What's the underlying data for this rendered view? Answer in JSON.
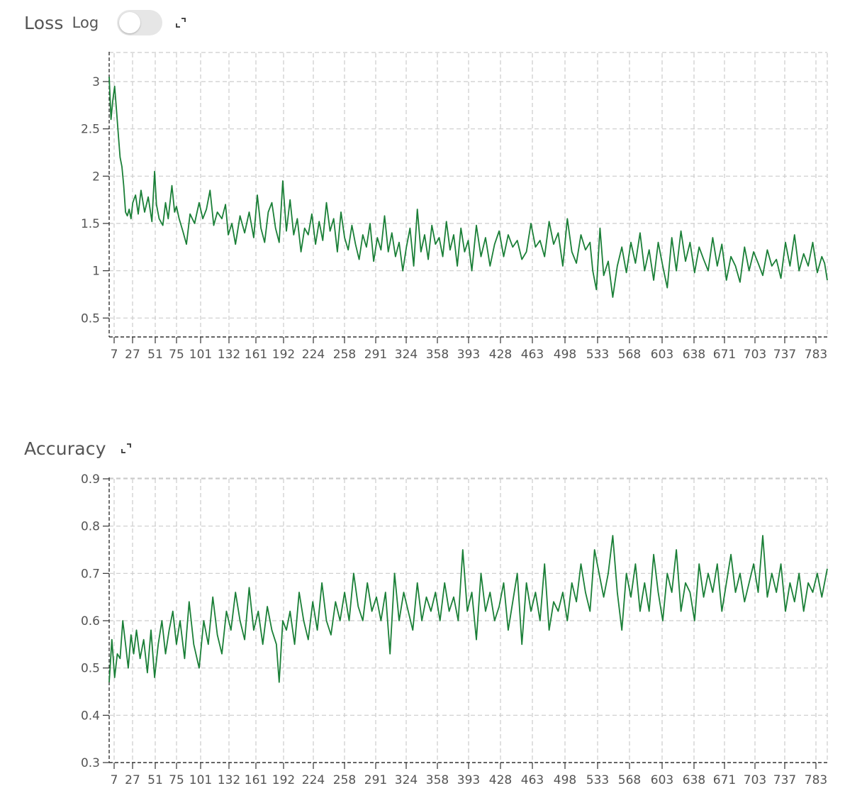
{
  "charts": {
    "loss": {
      "title": "Loss",
      "log_label": "Log",
      "log_enabled": false
    },
    "accuracy": {
      "title": "Accuracy"
    }
  },
  "colors": {
    "line": "#1a7f37",
    "grid": "#cccccc",
    "axis": "#333333",
    "toggle_off": "#e6e6e6"
  },
  "icons": {
    "expand": "expand-icon"
  },
  "chart_data": [
    {
      "type": "line",
      "title": "Loss",
      "xlabel": "",
      "ylabel": "",
      "ylim": [
        0.3,
        3.3
      ],
      "yticks": [
        "0.5",
        "1",
        "1.5",
        "2",
        "2.5",
        "3"
      ],
      "xtick_labels": [
        "7",
        "27",
        "51",
        "75",
        "101",
        "132",
        "161",
        "192",
        "224",
        "258",
        "291",
        "324",
        "358",
        "393",
        "428",
        "463",
        "498",
        "533",
        "568",
        "603",
        "638",
        "671",
        "703",
        "737",
        "783"
      ],
      "xlim": [
        1,
        791
      ],
      "grid": true,
      "series": [
        {
          "x": [
            1,
            3,
            5,
            7,
            9,
            11,
            13,
            15,
            17,
            19,
            21,
            23,
            25,
            27,
            30,
            33,
            36,
            40,
            44,
            48,
            51,
            53,
            56,
            60,
            63,
            66,
            70,
            73,
            75,
            78,
            82,
            86,
            90,
            95,
            100,
            104,
            108,
            112,
            116,
            120,
            125,
            129,
            132,
            136,
            140,
            145,
            150,
            155,
            160,
            164,
            168,
            172,
            176,
            180,
            184,
            188,
            192,
            196,
            200,
            204,
            208,
            212,
            216,
            220,
            224,
            228,
            232,
            236,
            240,
            244,
            248,
            252,
            256,
            260,
            264,
            268,
            272,
            276,
            280,
            284,
            288,
            292,
            296,
            300,
            304,
            308,
            312,
            316,
            320,
            324,
            328,
            332,
            336,
            340,
            344,
            348,
            352,
            356,
            360,
            364,
            368,
            372,
            376,
            380,
            384,
            388,
            392,
            396,
            400,
            405,
            410,
            415,
            420,
            425,
            430,
            435,
            440,
            445,
            450,
            455,
            460,
            465,
            470,
            475,
            480,
            485,
            490,
            495,
            500,
            505,
            510,
            515,
            520,
            525,
            530,
            533,
            537,
            541,
            545,
            550,
            555,
            560,
            565,
            570,
            575,
            580,
            585,
            590,
            595,
            600,
            605,
            610,
            615,
            620,
            625,
            630,
            635,
            640,
            645,
            650,
            655,
            660,
            665,
            670,
            675,
            680,
            685,
            690,
            695,
            700,
            705,
            710,
            715,
            720,
            725,
            730,
            735,
            740,
            745,
            750,
            755,
            760,
            765,
            770,
            775,
            780,
            785,
            788,
            791
          ],
          "values": [
            3.05,
            2.6,
            2.8,
            2.95,
            2.7,
            2.45,
            2.2,
            2.1,
            1.9,
            1.62,
            1.58,
            1.65,
            1.55,
            1.72,
            1.8,
            1.6,
            1.85,
            1.62,
            1.78,
            1.52,
            2.05,
            1.7,
            1.55,
            1.48,
            1.72,
            1.55,
            1.9,
            1.62,
            1.68,
            1.55,
            1.42,
            1.28,
            1.6,
            1.5,
            1.72,
            1.55,
            1.65,
            1.85,
            1.48,
            1.62,
            1.55,
            1.7,
            1.38,
            1.5,
            1.28,
            1.58,
            1.4,
            1.62,
            1.35,
            1.8,
            1.45,
            1.3,
            1.62,
            1.72,
            1.45,
            1.3,
            1.95,
            1.42,
            1.75,
            1.38,
            1.55,
            1.2,
            1.45,
            1.38,
            1.6,
            1.28,
            1.52,
            1.32,
            1.72,
            1.42,
            1.55,
            1.2,
            1.62,
            1.35,
            1.22,
            1.48,
            1.28,
            1.12,
            1.38,
            1.25,
            1.5,
            1.1,
            1.35,
            1.22,
            1.58,
            1.2,
            1.4,
            1.15,
            1.3,
            1.0,
            1.25,
            1.45,
            1.05,
            1.65,
            1.2,
            1.38,
            1.12,
            1.48,
            1.28,
            1.35,
            1.15,
            1.52,
            1.22,
            1.38,
            1.05,
            1.45,
            1.2,
            1.32,
            1.0,
            1.48,
            1.15,
            1.35,
            1.05,
            1.28,
            1.42,
            1.15,
            1.38,
            1.25,
            1.32,
            1.12,
            1.2,
            1.5,
            1.25,
            1.32,
            1.15,
            1.52,
            1.28,
            1.4,
            1.05,
            1.55,
            1.2,
            1.08,
            1.38,
            1.22,
            1.3,
            1.0,
            0.8,
            1.45,
            0.95,
            1.1,
            0.72,
            1.05,
            1.25,
            0.98,
            1.3,
            1.08,
            1.4,
            1.0,
            1.22,
            0.9,
            1.3,
            1.05,
            0.82,
            1.35,
            1.0,
            1.42,
            1.1,
            1.3,
            0.98,
            1.25,
            1.12,
            1.0,
            1.35,
            1.05,
            1.28,
            0.9,
            1.15,
            1.05,
            0.88,
            1.25,
            1.0,
            1.2,
            1.08,
            0.95,
            1.22,
            1.05,
            1.12,
            0.92,
            1.3,
            1.05,
            1.38,
            1.0,
            1.18,
            1.05,
            1.3,
            0.98,
            1.15,
            1.08,
            0.9
          ]
        }
      ]
    },
    {
      "type": "line",
      "title": "Accuracy",
      "xlabel": "",
      "ylabel": "",
      "ylim": [
        0.3,
        0.9
      ],
      "yticks": [
        "0.3",
        "0.4",
        "0.5",
        "0.6",
        "0.7",
        "0.8",
        "0.9"
      ],
      "xtick_labels": [
        "7",
        "27",
        "51",
        "75",
        "101",
        "132",
        "161",
        "192",
        "224",
        "258",
        "291",
        "324",
        "358",
        "393",
        "428",
        "463",
        "498",
        "533",
        "568",
        "603",
        "638",
        "671",
        "703",
        "737",
        "783"
      ],
      "xlim": [
        1,
        791
      ],
      "grid": true,
      "series": [
        {
          "x": [
            1,
            4,
            7,
            10,
            13,
            16,
            19,
            22,
            25,
            28,
            31,
            35,
            39,
            43,
            47,
            51,
            55,
            59,
            63,
            67,
            71,
            75,
            79,
            84,
            89,
            94,
            100,
            105,
            110,
            115,
            120,
            125,
            130,
            135,
            140,
            145,
            150,
            155,
            160,
            165,
            170,
            175,
            180,
            185,
            188,
            192,
            196,
            200,
            205,
            210,
            215,
            220,
            225,
            230,
            235,
            240,
            245,
            250,
            255,
            260,
            265,
            270,
            275,
            280,
            285,
            290,
            295,
            300,
            305,
            310,
            315,
            320,
            325,
            330,
            335,
            340,
            345,
            350,
            355,
            360,
            365,
            370,
            375,
            380,
            385,
            390,
            395,
            400,
            405,
            410,
            415,
            420,
            425,
            430,
            435,
            440,
            445,
            450,
            455,
            460,
            465,
            470,
            475,
            480,
            485,
            490,
            495,
            500,
            505,
            510,
            515,
            520,
            525,
            530,
            535,
            540,
            545,
            550,
            555,
            560,
            565,
            570,
            575,
            580,
            585,
            590,
            595,
            600,
            605,
            610,
            615,
            620,
            625,
            630,
            635,
            640,
            645,
            650,
            655,
            660,
            665,
            670,
            675,
            680,
            685,
            690,
            695,
            700,
            705,
            710,
            715,
            720,
            725,
            730,
            735,
            740,
            745,
            750,
            755,
            760,
            765,
            770,
            775,
            780,
            785,
            791
          ],
          "values": [
            0.47,
            0.56,
            0.48,
            0.53,
            0.52,
            0.6,
            0.55,
            0.5,
            0.57,
            0.53,
            0.58,
            0.52,
            0.56,
            0.49,
            0.58,
            0.48,
            0.55,
            0.6,
            0.53,
            0.58,
            0.62,
            0.55,
            0.6,
            0.52,
            0.64,
            0.55,
            0.5,
            0.6,
            0.55,
            0.65,
            0.57,
            0.53,
            0.62,
            0.58,
            0.66,
            0.6,
            0.56,
            0.67,
            0.58,
            0.62,
            0.55,
            0.63,
            0.58,
            0.55,
            0.47,
            0.6,
            0.58,
            0.62,
            0.55,
            0.66,
            0.6,
            0.56,
            0.64,
            0.58,
            0.68,
            0.6,
            0.57,
            0.64,
            0.6,
            0.66,
            0.6,
            0.7,
            0.63,
            0.6,
            0.68,
            0.62,
            0.65,
            0.6,
            0.66,
            0.53,
            0.7,
            0.6,
            0.66,
            0.62,
            0.58,
            0.68,
            0.6,
            0.65,
            0.62,
            0.66,
            0.6,
            0.68,
            0.62,
            0.65,
            0.6,
            0.75,
            0.62,
            0.66,
            0.56,
            0.7,
            0.62,
            0.66,
            0.6,
            0.63,
            0.68,
            0.58,
            0.64,
            0.7,
            0.55,
            0.68,
            0.62,
            0.66,
            0.6,
            0.72,
            0.58,
            0.64,
            0.62,
            0.66,
            0.6,
            0.68,
            0.64,
            0.72,
            0.66,
            0.62,
            0.75,
            0.7,
            0.65,
            0.7,
            0.78,
            0.66,
            0.58,
            0.7,
            0.65,
            0.72,
            0.62,
            0.68,
            0.62,
            0.74,
            0.66,
            0.6,
            0.7,
            0.66,
            0.75,
            0.62,
            0.68,
            0.66,
            0.6,
            0.72,
            0.65,
            0.7,
            0.66,
            0.72,
            0.62,
            0.68,
            0.74,
            0.66,
            0.7,
            0.64,
            0.68,
            0.72,
            0.66,
            0.78,
            0.65,
            0.7,
            0.66,
            0.72,
            0.62,
            0.68,
            0.64,
            0.7,
            0.62,
            0.68,
            0.66,
            0.7,
            0.65,
            0.71
          ]
        }
      ]
    }
  ]
}
